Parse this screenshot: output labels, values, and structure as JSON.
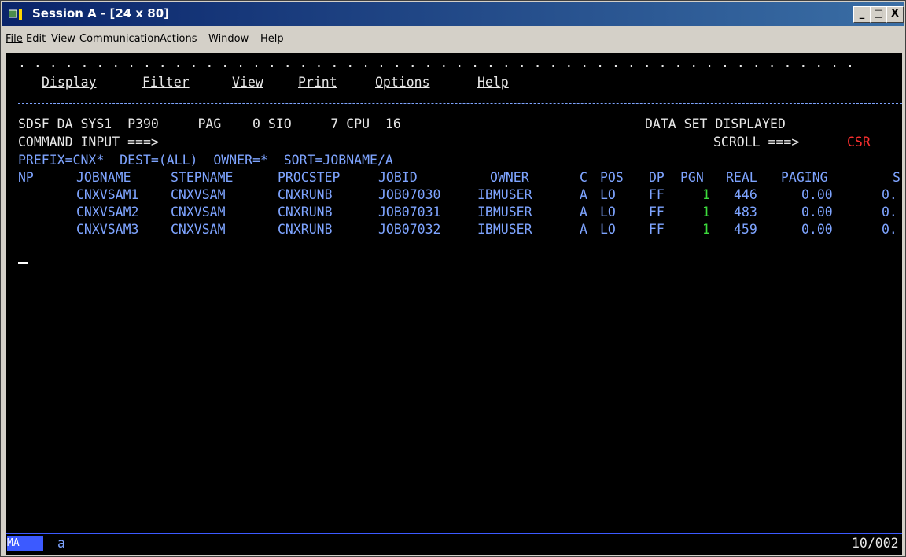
{
  "window": {
    "title": "Session A - [24 x 80]",
    "controls": {
      "minimize": "_",
      "maximize": "□",
      "close": "X"
    }
  },
  "menu": [
    "File",
    "Edit",
    "View",
    "Communication",
    "Actions",
    "Window",
    "Help"
  ],
  "terminal": {
    "dots": ". . . . . . . . . . . . . . . . . . . . . . . . . . . . . . . . . . . . . . . . . . . . . . . . . . . . . .",
    "action_bar": [
      "Display",
      "Filter",
      "View",
      "Print",
      "Options",
      "Help"
    ],
    "status": {
      "left": "SDSF DA SYS1  P390     PAG    0 SIO     7 CPU  16",
      "right": "DATA SET DISPLAYED"
    },
    "command": {
      "label": "COMMAND INPUT ===>",
      "scroll_label": "SCROLL ===>",
      "scroll_value": "CSR"
    },
    "filters": "PREFIX=CNX*  DEST=(ALL)  OWNER=*  SORT=JOBNAME/A",
    "headers": [
      "NP",
      "JOBNAME",
      "STEPNAME",
      "PROCSTEP",
      "JOBID",
      "OWNER",
      "C",
      "POS",
      "DP",
      "PGN",
      "REAL",
      "PAGING",
      "S"
    ],
    "rows": [
      {
        "jobname": "CNXVSAM1",
        "stepname": "CNXVSAM",
        "procstep": "CNXRUNB",
        "jobid": "JOB07030",
        "owner": "IBMUSER",
        "c": "A",
        "pos": "LO",
        "dp": "FF",
        "pgn": "1",
        "real": "446",
        "paging": "0.00",
        "s": "0."
      },
      {
        "jobname": "CNXVSAM2",
        "stepname": "CNXVSAM",
        "procstep": "CNXRUNB",
        "jobid": "JOB07031",
        "owner": "IBMUSER",
        "c": "A",
        "pos": "LO",
        "dp": "FF",
        "pgn": "1",
        "real": "483",
        "paging": "0.00",
        "s": "0."
      },
      {
        "jobname": "CNXVSAM3",
        "stepname": "CNXVSAM",
        "procstep": "CNXRUNB",
        "jobid": "JOB07032",
        "owner": "IBMUSER",
        "c": "A",
        "pos": "LO",
        "dp": "FF",
        "pgn": "1",
        "real": "459",
        "paging": "0.00",
        "s": "0."
      }
    ]
  },
  "oia": {
    "mode": "MA",
    "char": "a",
    "position": "10/002"
  },
  "colors": {
    "field_blue": "#7ea4ff",
    "text_white": "#e8e8e8",
    "pgn_green": "#3cdc3c",
    "scroll_red": "#ff3030",
    "oia_blue": "#3c5aff"
  }
}
